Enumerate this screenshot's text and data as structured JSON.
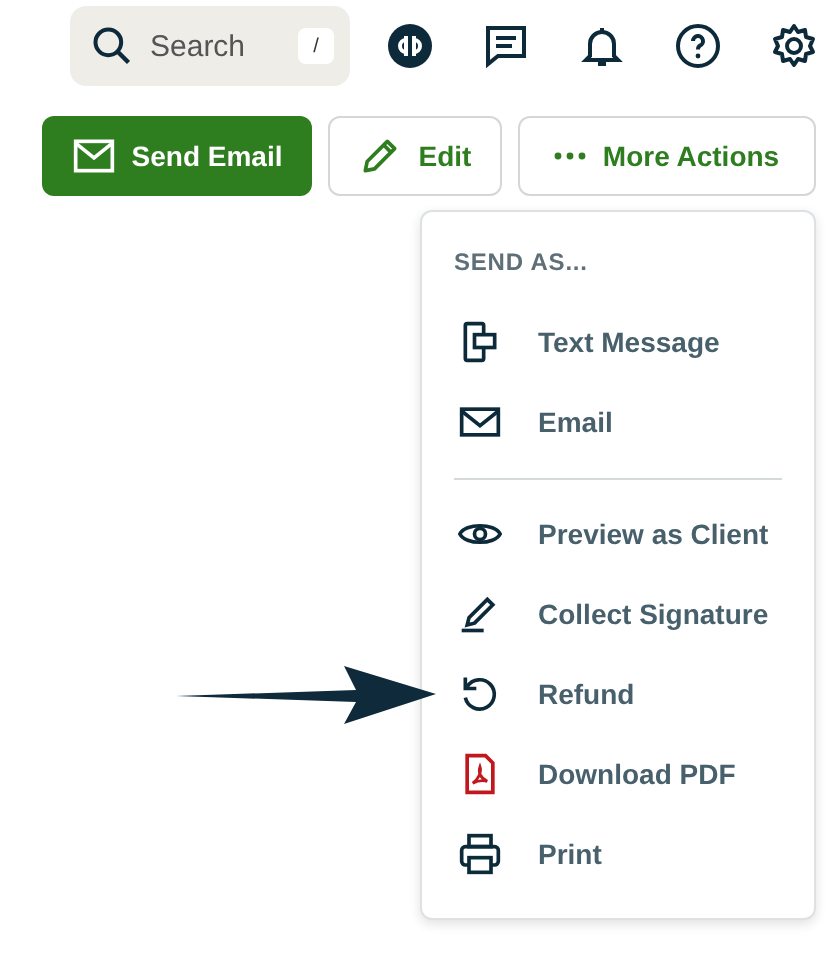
{
  "top_bar": {
    "search": {
      "placeholder": "Search",
      "shortcut": "/"
    },
    "icons": [
      {
        "kind": "brand"
      },
      {
        "kind": "chat"
      },
      {
        "kind": "bell"
      },
      {
        "kind": "help"
      },
      {
        "kind": "gear"
      }
    ]
  },
  "actions": [
    {
      "label": "Send Email",
      "kind": "primary"
    },
    {
      "label": "Edit",
      "kind": "edit"
    },
    {
      "label": "More Actions",
      "kind": "more",
      "expanded": true
    }
  ],
  "menu": {
    "header": "SEND AS...",
    "groups": [
      [
        {
          "label": "Text Message",
          "kind": "text"
        },
        {
          "label": "Email",
          "kind": "email"
        }
      ],
      [
        {
          "label": "Preview as Client",
          "kind": "preview"
        },
        {
          "label": "Collect Signature",
          "kind": "signature"
        },
        {
          "label": "Refund",
          "kind": "refund"
        },
        {
          "label": "Download PDF",
          "kind": "pdf"
        },
        {
          "label": "Print",
          "kind": "print"
        }
      ]
    ]
  },
  "annotation": {
    "kind": "arrow"
  }
}
